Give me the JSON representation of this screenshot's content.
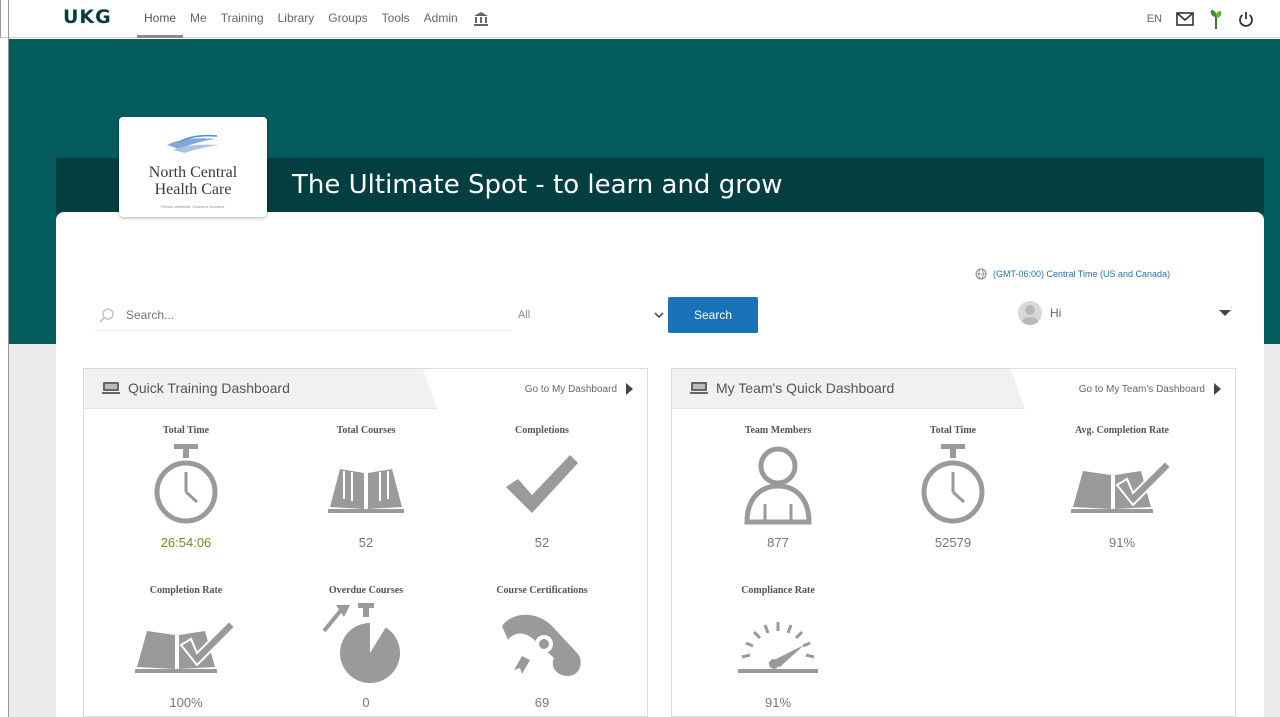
{
  "nav": {
    "logo": "UKG",
    "items": [
      "Home",
      "Me",
      "Training",
      "Library",
      "Groups",
      "Tools",
      "Admin"
    ],
    "active": "Home",
    "lang": "EN"
  },
  "brand": {
    "name_line1": "North Central",
    "name_line2": "Health Care",
    "tagline": "Person centered. Outcome focused."
  },
  "page": {
    "title": "The Ultimate Spot - to learn and grow"
  },
  "timezone": "(GMT-06:00) Central Time (US and Canada)",
  "search": {
    "placeholder": "Search...",
    "scope_selected": "All",
    "button_label": "Search"
  },
  "user": {
    "greeting": "Hi"
  },
  "colors": {
    "banner": "#045c5c",
    "title_bar": "#033e40",
    "search_button": "#1a73b8",
    "icon_gray": "#9a9a9a",
    "time_value_green": "#6b8e23"
  },
  "quick_training": {
    "title": "Quick Training Dashboard",
    "link": "Go to My Dashboard",
    "metrics": [
      {
        "label": "Total Time",
        "value": "26:54:06",
        "icon": "stopwatch-icon"
      },
      {
        "label": "Total Courses",
        "value": "52",
        "icon": "open-book-icon"
      },
      {
        "label": "Completions",
        "value": "52",
        "icon": "checkmark-icon"
      },
      {
        "label": "Completion Rate",
        "value": "100%",
        "icon": "book-check-icon"
      },
      {
        "label": "Overdue Courses",
        "value": "0",
        "icon": "overdue-timer-icon"
      },
      {
        "label": "Course Certifications",
        "value": "69",
        "icon": "certificate-scroll-icon"
      }
    ]
  },
  "team_dashboard": {
    "title": "My Team's Quick Dashboard",
    "link": "Go to My Team's Dashboard",
    "metrics": [
      {
        "label": "Team Members",
        "value": "877",
        "icon": "person-icon"
      },
      {
        "label": "Total Time",
        "value": "52579",
        "icon": "stopwatch-icon"
      },
      {
        "label": "Avg. Completion Rate",
        "value": "91%",
        "icon": "book-check-icon"
      },
      {
        "label": "Compliance Rate",
        "value": "91%",
        "icon": "gauge-icon"
      }
    ]
  }
}
